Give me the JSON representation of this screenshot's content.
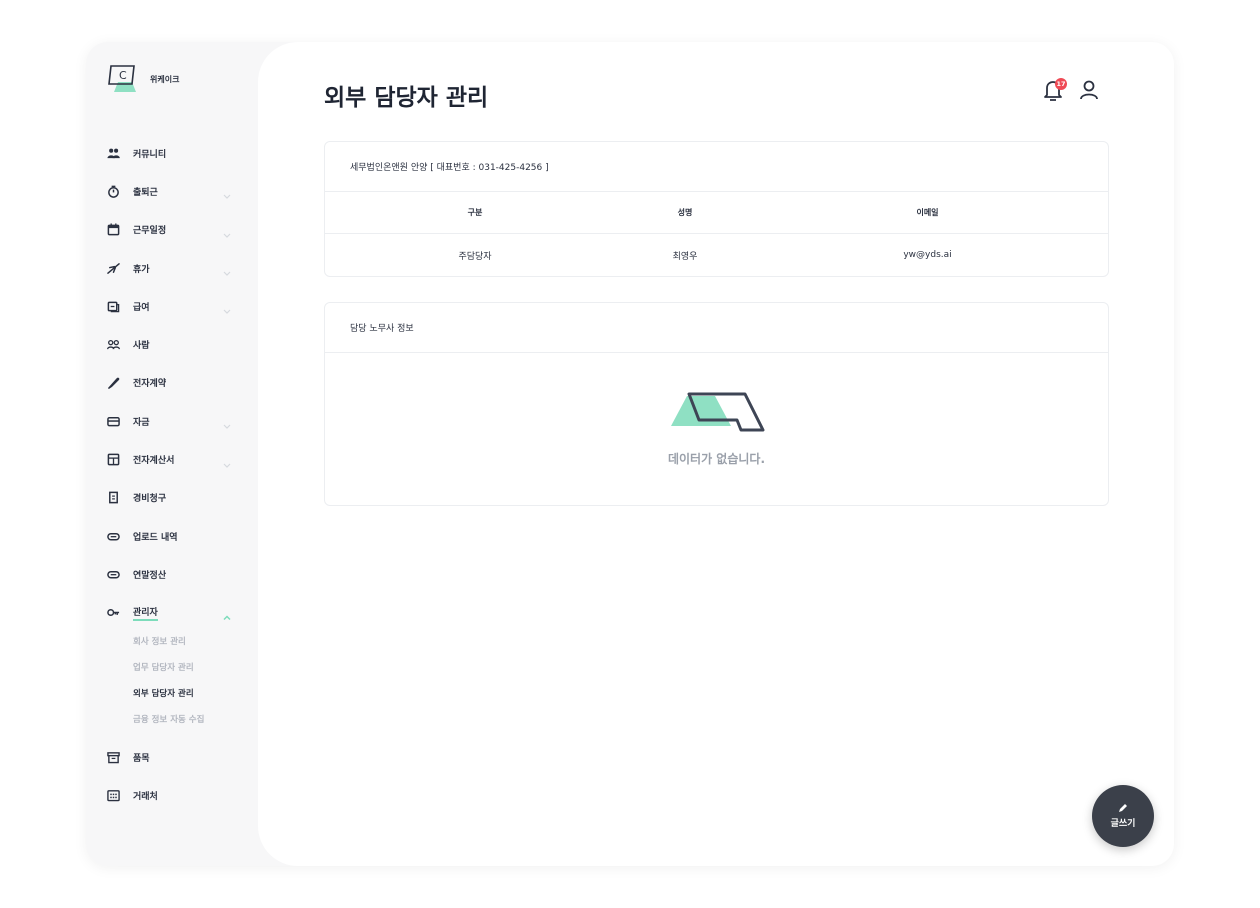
{
  "brand": {
    "name": "위케이크",
    "logo_letter": "C"
  },
  "page": {
    "title": "외부 담당자 관리"
  },
  "notifications": {
    "count": "17"
  },
  "sidebar": {
    "items": [
      {
        "label": "커뮤니티",
        "icon": "people-icon",
        "chevron": false
      },
      {
        "label": "출퇴근",
        "icon": "stopwatch-icon",
        "chevron": true
      },
      {
        "label": "근무일정",
        "icon": "calendar-icon",
        "chevron": true
      },
      {
        "label": "휴가",
        "icon": "airplane-icon",
        "chevron": true
      },
      {
        "label": "급여",
        "icon": "wallet-icon",
        "chevron": true
      },
      {
        "label": "사람",
        "icon": "users-icon",
        "chevron": false
      },
      {
        "label": "전자계약",
        "icon": "feather-icon",
        "chevron": false
      },
      {
        "label": "자금",
        "icon": "card-icon",
        "chevron": true
      },
      {
        "label": "전자계산서",
        "icon": "invoice-icon",
        "chevron": true
      },
      {
        "label": "경비청구",
        "icon": "receipt-icon",
        "chevron": false
      },
      {
        "label": "업로드 내역",
        "icon": "paperclip-icon",
        "chevron": false
      },
      {
        "label": "연말정산",
        "icon": "paperclip-icon",
        "chevron": false
      },
      {
        "label": "관리자",
        "icon": "key-icon",
        "chevron": true
      }
    ],
    "admin_sub": [
      {
        "label": "회사 정보 관리",
        "active": false
      },
      {
        "label": "업무 담당자 관리",
        "active": false
      },
      {
        "label": "외부 담당자 관리",
        "active": true
      },
      {
        "label": "금융 정보 자동 수집",
        "active": false
      }
    ],
    "bottom_items": [
      {
        "label": "품목",
        "icon": "archive-icon"
      },
      {
        "label": "거래처",
        "icon": "building-icon"
      }
    ]
  },
  "firm_card": {
    "header": "세무법인온앤원 안양 [ 대표번호 : 031-425-4256 ]",
    "columns": [
      "구분",
      "성명",
      "이메일"
    ],
    "rows": [
      [
        "주담당자",
        "최영우",
        "yw@yds.ai"
      ]
    ]
  },
  "labor_card": {
    "header": "담당 노무사 정보",
    "empty_text": "데이터가 없습니다."
  },
  "fab": {
    "label": "글쓰기"
  },
  "colors": {
    "accent": "#7ddcbb",
    "badge": "#ef4a55",
    "fab": "#3b404a"
  }
}
